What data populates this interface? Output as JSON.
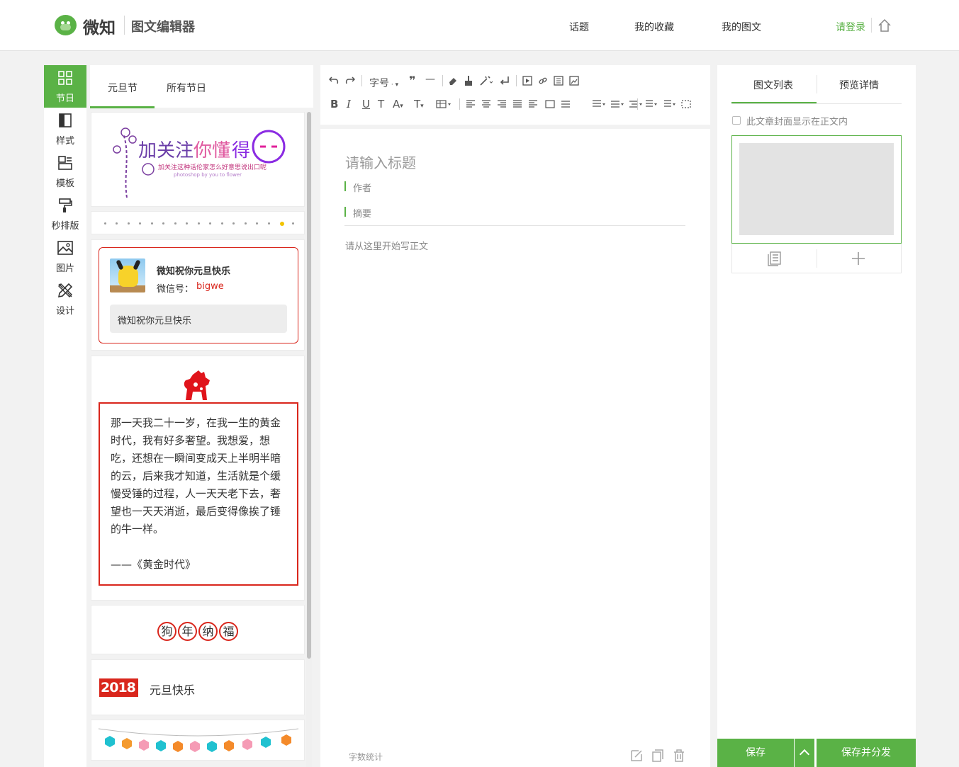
{
  "header": {
    "brand": "微知",
    "subtitle": "图文编辑器",
    "nav": [
      "话题",
      "我的收藏",
      "我的图文"
    ],
    "login": "请登录"
  },
  "sidebar": {
    "items": [
      {
        "label": "节日",
        "icon": "grid-icon",
        "active": true
      },
      {
        "label": "样式",
        "icon": "style-icon"
      },
      {
        "label": "模板",
        "icon": "template-icon"
      },
      {
        "label": "秒排版",
        "icon": "paint-roller-icon"
      },
      {
        "label": "图片",
        "icon": "image-icon"
      },
      {
        "label": "设计",
        "icon": "design-tools-icon"
      }
    ]
  },
  "panel": {
    "tabs": [
      "元旦节",
      "所有节日"
    ],
    "banner_image": "加关注 你懂得 banner",
    "wechat_card": {
      "name": "微知祝你元旦快乐",
      "id_label": "微信号：",
      "id": "bigwe",
      "message": "微知祝你元旦快乐"
    },
    "poem": {
      "text": "那一天我二十一岁，在我一生的黄金时代，我有好多奢望。我想爱，想吃，还想在一瞬间变成天上半明半暗的云，后来我才知道，生活就是个缓慢受锤的过程，人一天天老下去，奢望也一天天消逝，最后变得像挨了锤的牛一样。",
      "source": "——《黄金时代》"
    },
    "seals": [
      "狗",
      "年",
      "纳",
      "福"
    ],
    "newyear": {
      "badge": "2018",
      "text": "元旦快乐"
    }
  },
  "toolbar": {
    "font_size": "字号"
  },
  "editor": {
    "title_placeholder": "请输入标题",
    "author_placeholder": "作者",
    "summary_placeholder": "摘要",
    "body_placeholder": "请从这里开始写正文",
    "word_count": "字数统计"
  },
  "right": {
    "tabs": [
      "图文列表",
      "预览详情"
    ],
    "cover_checkbox": "此文章封面显示在正文内",
    "save": "保存",
    "save_share": "保存并分发"
  },
  "colors": {
    "accent": "#5ab246",
    "red": "#d9261c"
  }
}
